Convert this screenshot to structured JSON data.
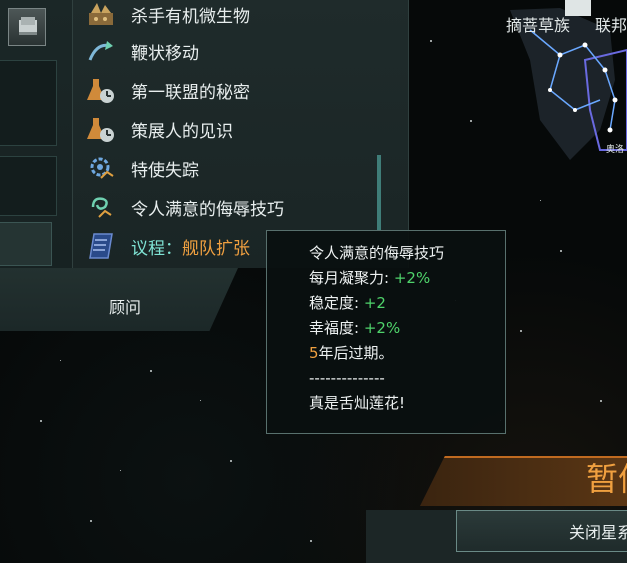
{
  "list": {
    "items": [
      {
        "label": "杀手有机微生物",
        "icon": "microbe-icon"
      },
      {
        "label": "鞭状移动",
        "icon": "whip-icon"
      },
      {
        "label": "第一联盟的秘密",
        "icon": "flask-clock-icon"
      },
      {
        "label": "策展人的见识",
        "icon": "flask-clock-icon"
      },
      {
        "label": "特使失踪",
        "icon": "gear-arrow-icon"
      },
      {
        "label": "令人满意的侮辱技巧",
        "icon": "swirl-arrow-icon"
      }
    ],
    "agenda_label": "议程：",
    "agenda_value": "舰队扩张"
  },
  "advisor": {
    "label": "顾问"
  },
  "tooltip": {
    "title": "令人满意的侮辱技巧",
    "stats": [
      {
        "label": "每月凝聚力: ",
        "value": "+2%"
      },
      {
        "label": "稳定度: ",
        "value": "+2"
      },
      {
        "label": "幸福度: ",
        "value": "+2%"
      }
    ],
    "expiry_num": "5",
    "expiry_text": "年后过期。",
    "divider": "--------------",
    "quote": "真是舌灿莲花!"
  },
  "map": {
    "label_1": "摘菩草族",
    "label_2": "联邦",
    "small_label": "奥洛"
  },
  "pause": {
    "label": "暂停"
  },
  "close_button": {
    "label": "关闭星系"
  },
  "colors": {
    "accent_orange": "#f0a040",
    "positive_green": "#4fd36b",
    "teal": "#7fe3d4"
  }
}
